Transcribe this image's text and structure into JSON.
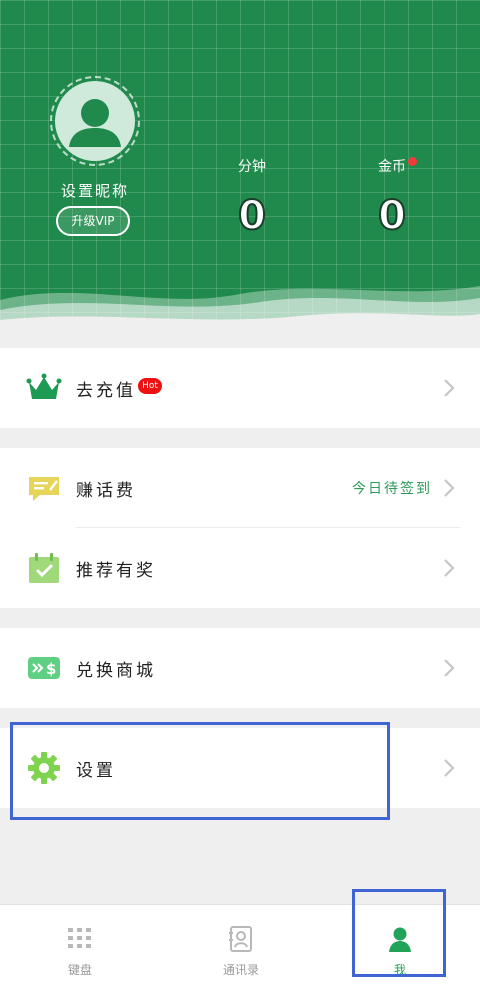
{
  "profile": {
    "nickname": "设置昵称",
    "vip_button": "升级VIP"
  },
  "stats": [
    {
      "label": "分钟",
      "value": "0"
    },
    {
      "label": "金币",
      "value": "0",
      "has_dot": true
    }
  ],
  "menu": {
    "recharge": {
      "label": "去充值",
      "badge": "Hot"
    },
    "earn_call_fee": {
      "label": "赚话费",
      "status": "今日待签到"
    },
    "referral": {
      "label": "推荐有奖"
    },
    "exchange_mall": {
      "label": "兑换商城"
    },
    "settings": {
      "label": "设置"
    }
  },
  "tabs": [
    {
      "label": "键盘",
      "icon": "keypad-icon",
      "active": false
    },
    {
      "label": "通讯录",
      "icon": "contacts-icon",
      "active": false
    },
    {
      "label": "我",
      "icon": "person-icon",
      "active": true
    }
  ],
  "colors": {
    "brand_green": "#1f8a4c",
    "active_tab": "#22a35a",
    "hot_badge": "#ee1111",
    "highlight_box": "#3f64d4"
  }
}
